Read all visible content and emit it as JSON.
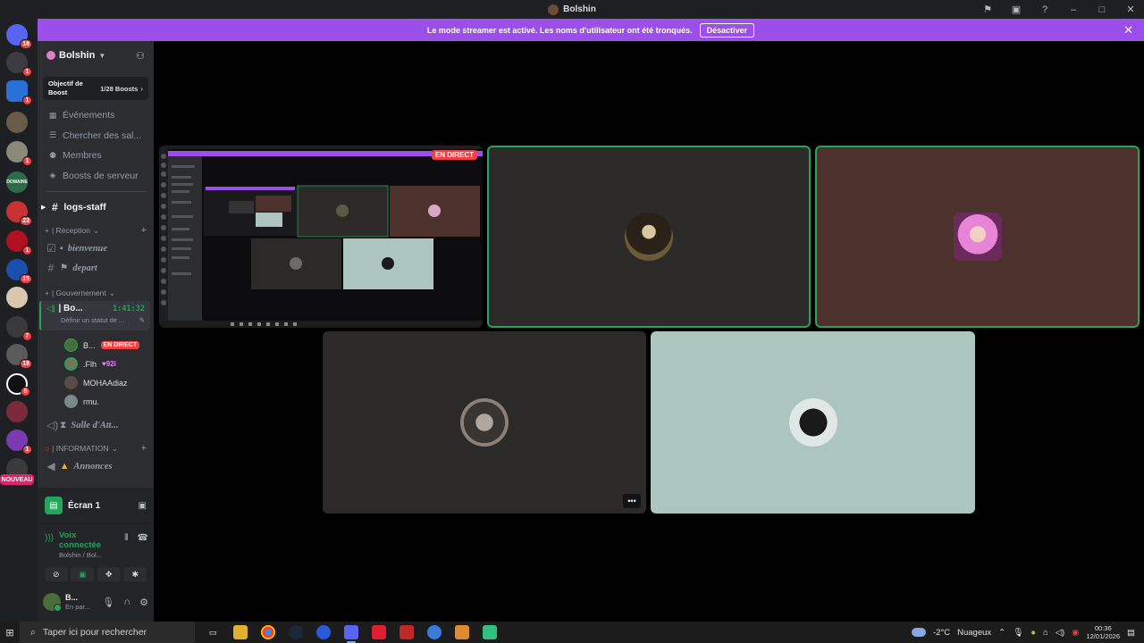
{
  "window": {
    "title": "Bolshin"
  },
  "banner": {
    "message": "Le mode streamer est activé. Les noms d'utilisateur ont été tronqués.",
    "button": "Désactiver"
  },
  "server_rail": {
    "badges": [
      "18",
      "1",
      "1",
      "1",
      "23",
      "1",
      "15",
      "7",
      "18",
      "5",
      "1"
    ],
    "new_label": "NOUVEAU",
    "server_text": "DOMAINE"
  },
  "server": {
    "name": "Bolshin",
    "boost_title": "Objectif de Boost",
    "boost_count": "1/28 Boosts"
  },
  "nav": [
    {
      "label": "Événements",
      "icon": "calendar-icon"
    },
    {
      "label": "Chercher des sal...",
      "icon": "search-icon"
    },
    {
      "label": "Membres",
      "icon": "members-icon"
    },
    {
      "label": "Boosts de serveur",
      "icon": "boost-icon"
    }
  ],
  "channels": {
    "logs": "logs-staff",
    "cat_reception": "| Réception",
    "bienvenue": "bienvenue",
    "depart": "depart",
    "cat_gouvernement": "| Gouvernement",
    "voice_channel": "| Bo...",
    "voice_timer": "1:41:32",
    "voice_status": "Définir un statut de ...",
    "cat_information": "| INFORMATION",
    "salle": "Salle d'Att...",
    "annonces": "Annonces"
  },
  "voice_users": [
    {
      "name": "B...",
      "badge": "EN DIRECT"
    },
    {
      "name": ".Flh",
      "badge": "92i"
    },
    {
      "name": "MOHAAdiaz",
      "badge": ""
    },
    {
      "name": "rmu.",
      "badge": ""
    }
  ],
  "screen_panel": {
    "label": "Écran 1"
  },
  "voice_connected": {
    "title": "Voix connectée",
    "subtitle": "Bolshin / Bol..."
  },
  "user_panel": {
    "name": "B...",
    "status": "En par..."
  },
  "stream": {
    "live_label": "EN DIRECT"
  },
  "taskbar": {
    "search_placeholder": "Taper ici pour rechercher",
    "temperature": "-2°C",
    "weather": "Nuageux",
    "time": "00:36",
    "date": "12/01/2026"
  },
  "colors": {
    "accent": "#9b4fe8",
    "green": "#23a55a",
    "red": "#f23f43"
  }
}
